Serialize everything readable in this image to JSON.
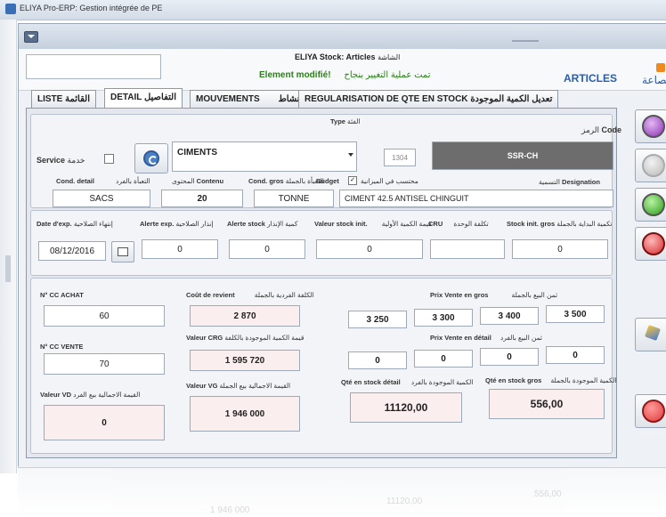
{
  "outer_title": "ELIYA Pro-ERP: Gestion intégrée de PE",
  "window_title": "ELIYA Stock: Articles",
  "window_title_ar": "الشاشة",
  "status_modified": "Element modifié!",
  "status_modified_ar": "تمت عملية التغيير بنجاح",
  "section_title": "ARTICLES",
  "section_title_ar": "مصاعة",
  "tabs": [
    {
      "label": "LISTE",
      "label_ar": "القائمة"
    },
    {
      "label": "DETAIL",
      "label_ar": "التفاصيل"
    },
    {
      "label": "MOUVEMENTS",
      "label_ar": "النشاط"
    },
    {
      "label": "REGULARISATION DE QTE EN STOCK",
      "label_ar": "تعديل الكمية الموجودة"
    }
  ],
  "type": {
    "label": "Type",
    "label_ar": "الفئة",
    "value": "CIMENTS"
  },
  "code": {
    "label": "Code",
    "label_ar": "الرمز",
    "num": "1304",
    "value": "SSR-CH"
  },
  "service": {
    "label": "Service",
    "label_ar": "خدمة"
  },
  "budget": {
    "label": "Budget",
    "label_ar": "محتسب في الميزانية"
  },
  "designation": {
    "label": "Designation",
    "label_ar": "التسمية",
    "value": "CIMENT 42.5 ANTISEL CHINGUIT"
  },
  "cond_detail": {
    "label": "Cond. detail",
    "label_ar": "التعبأة بالفرد",
    "value": "SACS"
  },
  "contenu": {
    "label": "Contenu",
    "label_ar": "المحتوى",
    "value": "20"
  },
  "cond_gros": {
    "label": "Cond. gros",
    "label_ar": "التعبأة بالجملة",
    "value": "TONNE"
  },
  "date_exp": {
    "label": "Date d'exp.",
    "label_ar": "إنتهاء الصلاحية",
    "value": "08/12/2016"
  },
  "alerte_exp": {
    "label": "Alerte exp.",
    "label_ar": "إنذار الصلاحية",
    "value": "0"
  },
  "alerte_stock": {
    "label": "Alerte stock",
    "label_ar": "كمية الإنذار",
    "value": "0"
  },
  "valeur_stock_init": {
    "label": "Valeur stock init.",
    "label_ar": "قيمة الكمية الأولية",
    "value": "0"
  },
  "cru": {
    "label": "CRU",
    "label_ar": "تكلفة الوحدة",
    "value": ""
  },
  "stock_init_gros": {
    "label": "Stock init. gros",
    "label_ar": "تكمية البداية بالجملة",
    "value": "0"
  },
  "cc_achat": {
    "label": "N° CC ACHAT",
    "value": "60"
  },
  "cc_vente": {
    "label": "N° CC VENTE",
    "value": "70"
  },
  "cout_revient": {
    "label": "Coût de revient",
    "label_ar": "الكلفة الفردية بالجملة",
    "value": "2 870"
  },
  "valeur_crg": {
    "label": "Valeur CRG",
    "label_ar": "قيمة الكمية الموجودة بالكلفة",
    "value": "1 595 720"
  },
  "valeur_vg": {
    "label": "Valeur VG",
    "label_ar": "القيمة الاجمالية بيع الجملة",
    "value": "1 946 000"
  },
  "valeur_vd": {
    "label": "Valeur VD",
    "label_ar": "القيمة الاجمالية بيع الفرد",
    "value": "0"
  },
  "prix_gros": {
    "label": "Prix Vente en gros",
    "label_ar": "ثمن البيع بالجملة",
    "values": [
      "3 250",
      "3 300",
      "3 400",
      "3 500"
    ]
  },
  "prix_detail": {
    "label": "Prix Vente en détail",
    "label_ar": "ثمن البيع بالفرد",
    "values": [
      "0",
      "0",
      "0",
      "0"
    ]
  },
  "qte_detail": {
    "label": "Qté en stock détail",
    "label_ar": "الكمية الموجودة بالفرد",
    "value": "11120,00"
  },
  "qte_gros": {
    "label": "Qté en stock gros",
    "label_ar": "الكمية الموجودة بالجملة",
    "value": "556,00"
  },
  "icons": {
    "refresh": "refresh-icon",
    "calendar": "calendar-icon",
    "purple": "purple-orb-icon",
    "grey": "grey-orb-icon",
    "green": "green-orb-icon",
    "trash": "trash-icon",
    "broom": "broom-icon",
    "power": "power-icon"
  },
  "colors": {
    "accent": "#2a5ea8",
    "modified": "#2f7d1e",
    "code_bg": "#6d6d6d",
    "power": "#e03b3b"
  },
  "reflection": {
    "values": [
      "1 946 000",
      "11120,00",
      "556,00"
    ]
  }
}
